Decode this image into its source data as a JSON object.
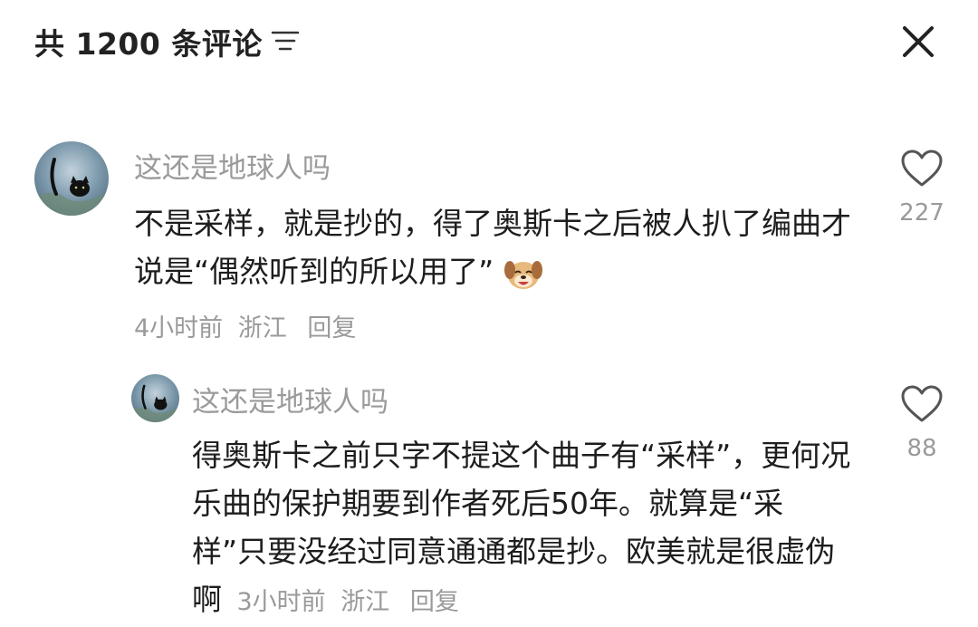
{
  "header": {
    "title": "共 1200 条评论"
  },
  "icons": {
    "filter": "filter-icon",
    "close": "close-icon",
    "heart": "heart-outline-icon",
    "dog_emoji": "dog-laugh-emoji-icon"
  },
  "comments": [
    {
      "username": "这还是地球人吗",
      "text": "不是采样，就是抄的，得了奥斯卡之后被人扒了编曲才说是“偶然听到的所以用了”",
      "time": "4小时前",
      "location": "浙江",
      "reply_label": "回复",
      "likes": "227"
    },
    {
      "username": "这还是地球人吗",
      "text": "得奥斯卡之前只字不提这个曲子有“采样”，更何况乐曲的保护期要到作者死后50年。就算是“采样”只要没经过同意通通都是抄。欧美就是很虚伪啊",
      "time": "3小时前",
      "location": "浙江",
      "reply_label": "回复",
      "likes": "88"
    }
  ]
}
